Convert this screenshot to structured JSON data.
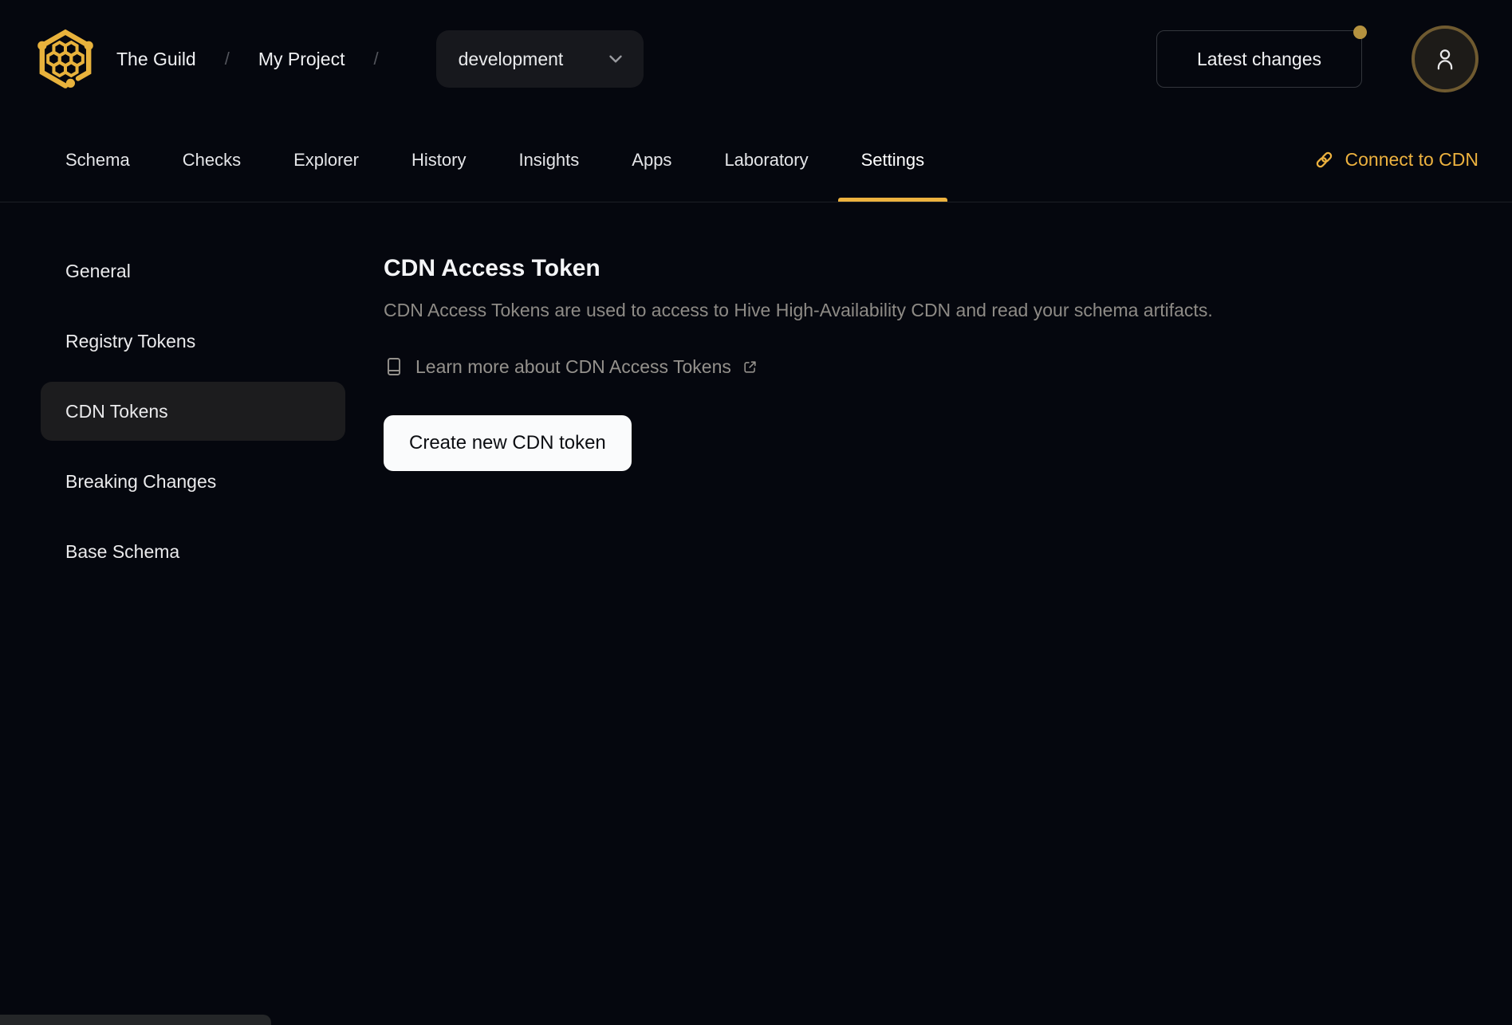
{
  "header": {
    "logo_icon": "hive-honeycomb-logo",
    "breadcrumb": {
      "org": "The Guild",
      "separator": "/",
      "project": "My Project"
    },
    "target_selector": {
      "value": "development",
      "chevron_icon": "chevron-down-icon"
    },
    "latest_changes_label": "Latest changes",
    "notification_dot": true,
    "user_avatar_icon": "user-icon"
  },
  "tabs": {
    "items": [
      "Schema",
      "Checks",
      "Explorer",
      "History",
      "Insights",
      "Apps",
      "Laboratory",
      "Settings"
    ],
    "active_tab": "Settings",
    "connect_cdn_label": "Connect to CDN",
    "connect_cdn_icon": "link-icon"
  },
  "sidebar": {
    "items": [
      "General",
      "Registry Tokens",
      "CDN Tokens",
      "Breaking Changes",
      "Base Schema"
    ],
    "active_item": "CDN Tokens"
  },
  "main": {
    "title": "CDN Access Token",
    "description": "CDN Access Tokens are used to access to Hive High-Availability CDN and read your schema artifacts.",
    "learn_more_label": "Learn more about CDN Access Tokens",
    "learn_more_icons": [
      "book-icon",
      "external-link-icon"
    ],
    "create_button_label": "Create new CDN token"
  },
  "colors": {
    "accent_gold": "#edb23f",
    "notification_dot": "#b5923f",
    "avatar_border": "#6f5a30",
    "create_button_bg": "#fafbfc",
    "background": "#05070e",
    "active_sidebar_bg": "#1c1c1e"
  }
}
